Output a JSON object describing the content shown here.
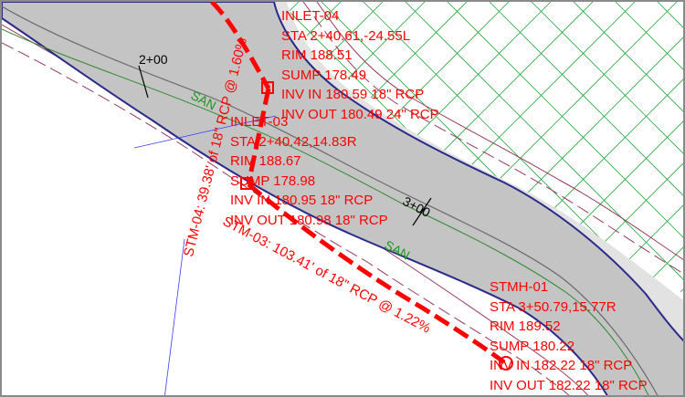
{
  "colors": {
    "road_fill": "#c4c4c4",
    "curb": "#2a2a8a",
    "storm": "#ff0000",
    "sanitary_label": "#1a9a1a",
    "grid": "#27a640",
    "offset_line": "#9a3a5a",
    "property_line": "#3a3aff"
  },
  "stations": [
    "2+00",
    "3+00"
  ],
  "sanitary_label": "SAN",
  "pipe_labels": {
    "stm04": "STM-04: 39.38' of 18\" RCP @ 1.60%",
    "stm03": "STM-03: 103.41' of 18\" RCP @ 1.22%"
  },
  "structures": [
    {
      "id": "INLET-04",
      "lines": [
        "INLET-04",
        "STA 2+40.61,-24.55L",
        "RIM 188.51",
        "SUMP 178.49",
        "INV IN 180.59 18\" RCP",
        "INV OUT 180.49 24\" RCP"
      ]
    },
    {
      "id": "INLET-03",
      "lines": [
        "INLET-03",
        "STA 2+40.42,14.83R",
        "RIM 188.67",
        "SUMP 178.98",
        "INV IN 180.95 18\" RCP",
        "INV OUT 180.98 18\" RCP"
      ]
    },
    {
      "id": "STMH-01",
      "lines": [
        "STMH-01",
        "STA 3+50.79,15.77R",
        "RIM 189.52",
        "SUMP 180.22",
        "INV IN 182.22 18\" RCP",
        "INV OUT 182.22 18\" RCP"
      ]
    }
  ]
}
